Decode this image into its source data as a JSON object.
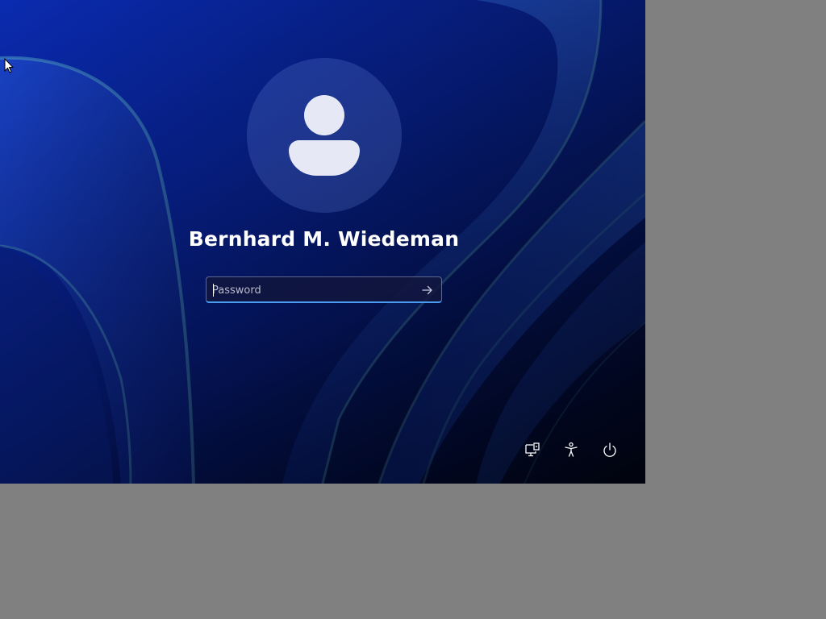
{
  "lock_screen": {
    "user_name": "Bernhard M. Wiedeman",
    "password_placeholder": "Password",
    "password_value": ""
  },
  "icons": {
    "avatar": "user-avatar-icon",
    "submit": "arrow-right-icon",
    "network": "network-icon",
    "accessibility": "accessibility-icon",
    "power": "power-icon",
    "cursor": "mouse-pointer-icon"
  },
  "colors": {
    "wallpaper_primary": "#0826a4",
    "wallpaper_dark": "#020b33",
    "ribbon_highlight": "#4fa0c8",
    "input_focus_border": "#4a9cf0",
    "outside_area": "#808080",
    "text": "#ffffff"
  }
}
